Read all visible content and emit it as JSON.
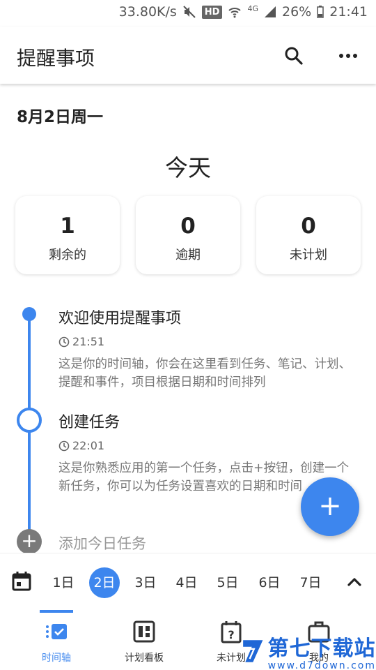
{
  "status_bar": {
    "speed": "33.80K/s",
    "hd": "HD",
    "network": "4G",
    "battery": "26%",
    "time": "21:41"
  },
  "app_bar": {
    "title": "提醒事项",
    "search_icon": "search-icon",
    "more_icon": "more-horizontal-icon"
  },
  "date_header": "8月2日周一",
  "today_title": "今天",
  "stats": [
    {
      "count": "1",
      "label": "剩余的"
    },
    {
      "count": "0",
      "label": "逾期"
    },
    {
      "count": "0",
      "label": "未计划"
    }
  ],
  "timeline": [
    {
      "title": "欢迎使用提醒事项",
      "time": "21:51",
      "description": "这是你的时间轴，你会在这里看到任务、笔记、计划、提醒和事件，项目根据日期和时间排列"
    },
    {
      "title": "创建任务",
      "time": "22:01",
      "description": "这是你熟悉应用的第一个任务，点击+按钮，创建一个新任务，你可以为任务设置喜欢的日期和时间"
    }
  ],
  "add_task_label": "添加今日任务",
  "fab_label": "+",
  "day_bar": {
    "days": [
      "1日",
      "2日",
      "3日",
      "4日",
      "5日",
      "6日",
      "7日"
    ],
    "selected_index": 1
  },
  "bottom_nav": [
    {
      "label": "时间轴",
      "icon": "timeline-check-icon",
      "active": true
    },
    {
      "label": "计划看板",
      "icon": "board-icon",
      "active": false
    },
    {
      "label": "未计划",
      "icon": "unplanned-calendar-icon",
      "active": false
    },
    {
      "label": "我的",
      "icon": "briefcase-icon",
      "active": false
    }
  ],
  "watermark": {
    "title": "第七下载站",
    "domain": "www.d7down.com"
  },
  "colors": {
    "accent": "#3d86ee",
    "text": "#222222",
    "muted": "#777777"
  }
}
